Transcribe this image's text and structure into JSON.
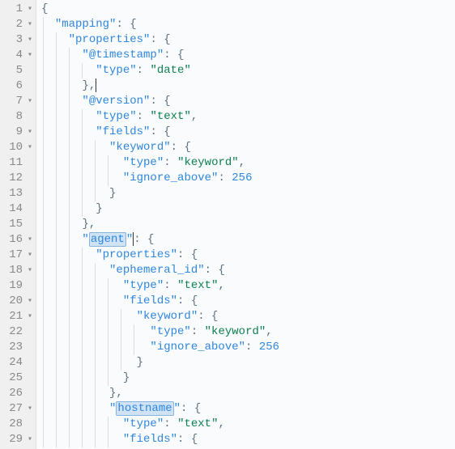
{
  "lines": [
    {
      "num": "1",
      "fold": "▾",
      "guides": [],
      "segs": [
        {
          "t": "{",
          "c": "punc"
        }
      ]
    },
    {
      "num": "2",
      "fold": "▾",
      "guides": [
        0
      ],
      "indent": 2,
      "segs": [
        {
          "t": "\"mapping\"",
          "c": "key"
        },
        {
          "t": ": {",
          "c": "punc"
        }
      ]
    },
    {
      "num": "3",
      "fold": "▾",
      "guides": [
        0,
        1
      ],
      "indent": 4,
      "segs": [
        {
          "t": "\"properties\"",
          "c": "key"
        },
        {
          "t": ": {",
          "c": "punc"
        }
      ]
    },
    {
      "num": "4",
      "fold": "▾",
      "guides": [
        0,
        1,
        2
      ],
      "indent": 6,
      "segs": [
        {
          "t": "\"@timestamp\"",
          "c": "key"
        },
        {
          "t": ": {",
          "c": "punc"
        }
      ]
    },
    {
      "num": "5",
      "fold": "",
      "guides": [
        0,
        1,
        2,
        3
      ],
      "indent": 8,
      "segs": [
        {
          "t": "\"type\"",
          "c": "key"
        },
        {
          "t": ": ",
          "c": "punc"
        },
        {
          "t": "\"date\"",
          "c": "str"
        }
      ]
    },
    {
      "num": "6",
      "fold": "",
      "guides": [
        0,
        1,
        2
      ],
      "indent": 6,
      "segs": [
        {
          "t": "},",
          "c": "punc",
          "cursor": true
        }
      ]
    },
    {
      "num": "7",
      "fold": "▾",
      "guides": [
        0,
        1,
        2
      ],
      "indent": 6,
      "segs": [
        {
          "t": "\"@version\"",
          "c": "key"
        },
        {
          "t": ": {",
          "c": "punc"
        }
      ]
    },
    {
      "num": "8",
      "fold": "",
      "guides": [
        0,
        1,
        2,
        3
      ],
      "indent": 8,
      "segs": [
        {
          "t": "\"type\"",
          "c": "key"
        },
        {
          "t": ": ",
          "c": "punc"
        },
        {
          "t": "\"text\"",
          "c": "str"
        },
        {
          "t": ",",
          "c": "punc"
        }
      ]
    },
    {
      "num": "9",
      "fold": "▾",
      "guides": [
        0,
        1,
        2,
        3
      ],
      "indent": 8,
      "segs": [
        {
          "t": "\"fields\"",
          "c": "key"
        },
        {
          "t": ": {",
          "c": "punc"
        }
      ]
    },
    {
      "num": "10",
      "fold": "▾",
      "guides": [
        0,
        1,
        2,
        3,
        4
      ],
      "indent": 10,
      "segs": [
        {
          "t": "\"keyword\"",
          "c": "key"
        },
        {
          "t": ": {",
          "c": "punc"
        }
      ]
    },
    {
      "num": "11",
      "fold": "",
      "guides": [
        0,
        1,
        2,
        3,
        4,
        5
      ],
      "indent": 12,
      "segs": [
        {
          "t": "\"type\"",
          "c": "key"
        },
        {
          "t": ": ",
          "c": "punc"
        },
        {
          "t": "\"keyword\"",
          "c": "str"
        },
        {
          "t": ",",
          "c": "punc"
        }
      ]
    },
    {
      "num": "12",
      "fold": "",
      "guides": [
        0,
        1,
        2,
        3,
        4,
        5
      ],
      "indent": 12,
      "segs": [
        {
          "t": "\"ignore_above\"",
          "c": "key"
        },
        {
          "t": ": ",
          "c": "punc"
        },
        {
          "t": "256",
          "c": "num"
        }
      ]
    },
    {
      "num": "13",
      "fold": "",
      "guides": [
        0,
        1,
        2,
        3,
        4
      ],
      "indent": 10,
      "segs": [
        {
          "t": "}",
          "c": "punc"
        }
      ]
    },
    {
      "num": "14",
      "fold": "",
      "guides": [
        0,
        1,
        2,
        3
      ],
      "indent": 8,
      "segs": [
        {
          "t": "}",
          "c": "punc"
        }
      ]
    },
    {
      "num": "15",
      "fold": "",
      "guides": [
        0,
        1,
        2
      ],
      "indent": 6,
      "segs": [
        {
          "t": "},",
          "c": "punc"
        }
      ]
    },
    {
      "num": "16",
      "fold": "▾",
      "guides": [
        0,
        1,
        2
      ],
      "indent": 6,
      "segs": [
        {
          "t": "\"",
          "c": "key"
        },
        {
          "t": "agent",
          "c": "key",
          "hl": true
        },
        {
          "t": "\"",
          "c": "key",
          "cursor": true
        },
        {
          "t": ": {",
          "c": "punc"
        }
      ]
    },
    {
      "num": "17",
      "fold": "▾",
      "guides": [
        0,
        1,
        2,
        3
      ],
      "indent": 8,
      "segs": [
        {
          "t": "\"properties\"",
          "c": "key"
        },
        {
          "t": ": {",
          "c": "punc"
        }
      ]
    },
    {
      "num": "18",
      "fold": "▾",
      "guides": [
        0,
        1,
        2,
        3,
        4
      ],
      "indent": 10,
      "segs": [
        {
          "t": "\"ephemeral_id\"",
          "c": "key"
        },
        {
          "t": ": {",
          "c": "punc"
        }
      ]
    },
    {
      "num": "19",
      "fold": "",
      "guides": [
        0,
        1,
        2,
        3,
        4,
        5
      ],
      "indent": 12,
      "segs": [
        {
          "t": "\"type\"",
          "c": "key"
        },
        {
          "t": ": ",
          "c": "punc"
        },
        {
          "t": "\"text\"",
          "c": "str"
        },
        {
          "t": ",",
          "c": "punc"
        }
      ]
    },
    {
      "num": "20",
      "fold": "▾",
      "guides": [
        0,
        1,
        2,
        3,
        4,
        5
      ],
      "indent": 12,
      "segs": [
        {
          "t": "\"fields\"",
          "c": "key"
        },
        {
          "t": ": {",
          "c": "punc"
        }
      ]
    },
    {
      "num": "21",
      "fold": "▾",
      "guides": [
        0,
        1,
        2,
        3,
        4,
        5,
        6
      ],
      "indent": 14,
      "segs": [
        {
          "t": "\"keyword\"",
          "c": "key"
        },
        {
          "t": ": {",
          "c": "punc"
        }
      ]
    },
    {
      "num": "22",
      "fold": "",
      "guides": [
        0,
        1,
        2,
        3,
        4,
        5,
        6,
        7
      ],
      "indent": 16,
      "segs": [
        {
          "t": "\"type\"",
          "c": "key"
        },
        {
          "t": ": ",
          "c": "punc"
        },
        {
          "t": "\"keyword\"",
          "c": "str"
        },
        {
          "t": ",",
          "c": "punc"
        }
      ]
    },
    {
      "num": "23",
      "fold": "",
      "guides": [
        0,
        1,
        2,
        3,
        4,
        5,
        6,
        7
      ],
      "indent": 16,
      "segs": [
        {
          "t": "\"ignore_above\"",
          "c": "key"
        },
        {
          "t": ": ",
          "c": "punc"
        },
        {
          "t": "256",
          "c": "num"
        }
      ]
    },
    {
      "num": "24",
      "fold": "",
      "guides": [
        0,
        1,
        2,
        3,
        4,
        5,
        6
      ],
      "indent": 14,
      "segs": [
        {
          "t": "}",
          "c": "punc"
        }
      ]
    },
    {
      "num": "25",
      "fold": "",
      "guides": [
        0,
        1,
        2,
        3,
        4,
        5
      ],
      "indent": 12,
      "segs": [
        {
          "t": "}",
          "c": "punc"
        }
      ]
    },
    {
      "num": "26",
      "fold": "",
      "guides": [
        0,
        1,
        2,
        3,
        4
      ],
      "indent": 10,
      "segs": [
        {
          "t": "},",
          "c": "punc"
        }
      ]
    },
    {
      "num": "27",
      "fold": "▾",
      "guides": [
        0,
        1,
        2,
        3,
        4
      ],
      "indent": 10,
      "segs": [
        {
          "t": "\"",
          "c": "key"
        },
        {
          "t": "hostname",
          "c": "key",
          "hl": true
        },
        {
          "t": "\"",
          "c": "key"
        },
        {
          "t": ": {",
          "c": "punc"
        }
      ]
    },
    {
      "num": "28",
      "fold": "",
      "guides": [
        0,
        1,
        2,
        3,
        4,
        5
      ],
      "indent": 12,
      "segs": [
        {
          "t": "\"type\"",
          "c": "key"
        },
        {
          "t": ": ",
          "c": "punc"
        },
        {
          "t": "\"text\"",
          "c": "str"
        },
        {
          "t": ",",
          "c": "punc"
        }
      ]
    },
    {
      "num": "29",
      "fold": "▾",
      "guides": [
        0,
        1,
        2,
        3,
        4,
        5
      ],
      "indent": 12,
      "segs": [
        {
          "t": "\"fields\"",
          "c": "key"
        },
        {
          "t": ": {",
          "c": "punc"
        }
      ]
    }
  ]
}
